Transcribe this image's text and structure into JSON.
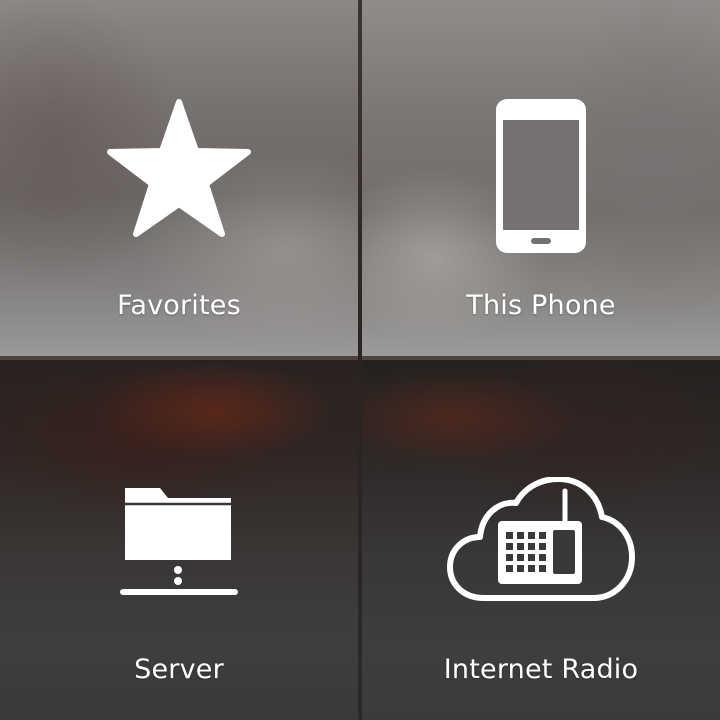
{
  "tiles": [
    {
      "label": "Favorites",
      "icon": "star-icon"
    },
    {
      "label": "This Phone",
      "icon": "phone-icon"
    },
    {
      "label": "Server",
      "icon": "network-folder-icon"
    },
    {
      "label": "Internet Radio",
      "icon": "cloud-radio-icon"
    }
  ],
  "colors": {
    "icon": "#ffffff",
    "label": "#ffffff",
    "divider": "#2a2322"
  }
}
